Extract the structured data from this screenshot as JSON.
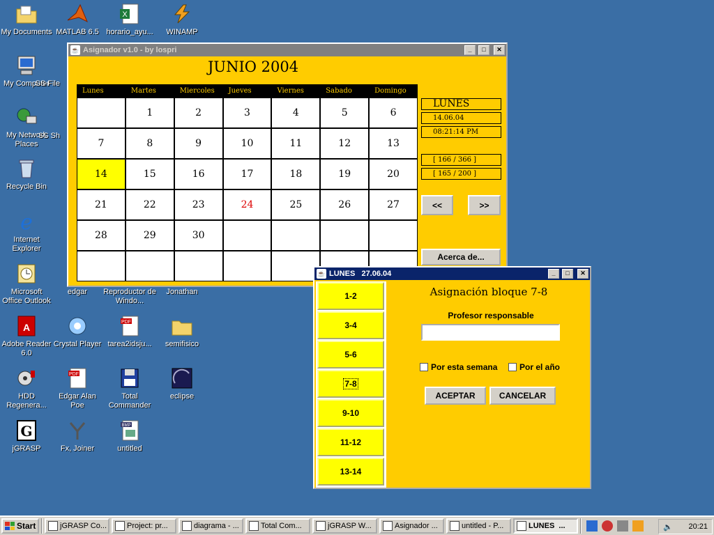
{
  "desktop_icons": [
    {
      "label": "My Documents",
      "icon": "folder-documents-icon"
    },
    {
      "label": "MATLAB 6.5",
      "icon": "matlab-icon"
    },
    {
      "label": "horario_ayu...",
      "icon": "excel-file-icon"
    },
    {
      "label": "WINAMP",
      "icon": "winamp-icon"
    },
    {
      "label": "My Computer",
      "icon": "computer-icon"
    },
    {
      "label": "SS File",
      "icon": "partial-icon"
    },
    {
      "label": "My Network Places",
      "icon": "network-icon"
    },
    {
      "label": "SS Sh",
      "icon": "partial-icon"
    },
    {
      "label": "Recycle Bin",
      "icon": "recycle-bin-icon"
    },
    {
      "label": "Internet Explorer",
      "icon": "ie-icon"
    },
    {
      "label": "Microsoft Office Outlook",
      "icon": "outlook-icon"
    },
    {
      "label": "edgar",
      "icon": "hidden-icon"
    },
    {
      "label": "Reproductor de Windo...",
      "icon": "hidden-icon"
    },
    {
      "label": "Jonathan",
      "icon": "hidden-icon"
    },
    {
      "label": "Adobe Reader 6.0",
      "icon": "adobe-reader-icon"
    },
    {
      "label": "Crystal Player",
      "icon": "crystal-player-icon"
    },
    {
      "label": "tarea2idsju...",
      "icon": "pdf-file-icon"
    },
    {
      "label": "semifisico",
      "icon": "folder-icon"
    },
    {
      "label": "HDD Regenera...",
      "icon": "hdd-regenerator-icon"
    },
    {
      "label": "Edgar Alan Poe",
      "icon": "pdf-file-icon"
    },
    {
      "label": "Total Commander",
      "icon": "floppy-icon"
    },
    {
      "label": "eclipse",
      "icon": "eclipse-icon"
    },
    {
      "label": "jGRASP",
      "icon": "jgrasp-icon"
    },
    {
      "label": "Fx, Joiner",
      "icon": "joiner-icon"
    },
    {
      "label": "untitled",
      "icon": "bmp-file-icon"
    }
  ],
  "main_window": {
    "title": "Asignador v1.0  - by lospri",
    "month_title": "JUNIO 2004",
    "weekdays": [
      "Lunes",
      "Martes",
      "Miercoles",
      "Jueves",
      "Viernes",
      "Sabado",
      "Domingo"
    ],
    "days": [
      "",
      "1",
      "2",
      "3",
      "4",
      "5",
      "6",
      "7",
      "8",
      "9",
      "10",
      "11",
      "12",
      "13",
      "14",
      "15",
      "16",
      "17",
      "18",
      "19",
      "20",
      "21",
      "22",
      "23",
      "24",
      "25",
      "26",
      "27",
      "28",
      "29",
      "30",
      "",
      "",
      "",
      "",
      "",
      "",
      "",
      "",
      "",
      "",
      ""
    ],
    "today_day": "14",
    "holiday_day": "24",
    "info": {
      "day_name": "LUNES",
      "date": "14.06.04",
      "time": "08:21:14 PM",
      "counter_year": "[ 166 / 366 ]",
      "counter_other": "[ 165 / 200 ]"
    },
    "prev_label": "<<",
    "next_label": ">>",
    "about_label": "Acerca de..."
  },
  "dialog": {
    "title": "LUNES   27.06.04",
    "slots": [
      "1-2",
      "3-4",
      "5-6",
      "7-8",
      "9-10",
      "11-12",
      "13-14"
    ],
    "selected_slot": "7-8",
    "heading": "Asignación bloque 7-8",
    "field_label": "Profesor responsable",
    "field_value": "",
    "check_week": "Por esta semana",
    "check_year": "Por el año",
    "accept_label": "ACEPTAR",
    "cancel_label": "CANCELAR"
  },
  "taskbar": {
    "start_label": "Start",
    "tasks": [
      "jGRASP Co...",
      "Project: pr...",
      "diagrama - ...",
      "Total Com...",
      "jGRASP W...",
      "Asignador ...",
      "untitled - P...",
      "LUNES  ..."
    ],
    "active_task": "LUNES  ...",
    "clock": "20:21"
  },
  "colors": {
    "desktop": "#3a6ea5",
    "app_bg": "#ffcc00",
    "today": "#ffff00",
    "holiday": "#dd0000",
    "title_active": "#0a246a",
    "title_inactive": "#808080"
  }
}
